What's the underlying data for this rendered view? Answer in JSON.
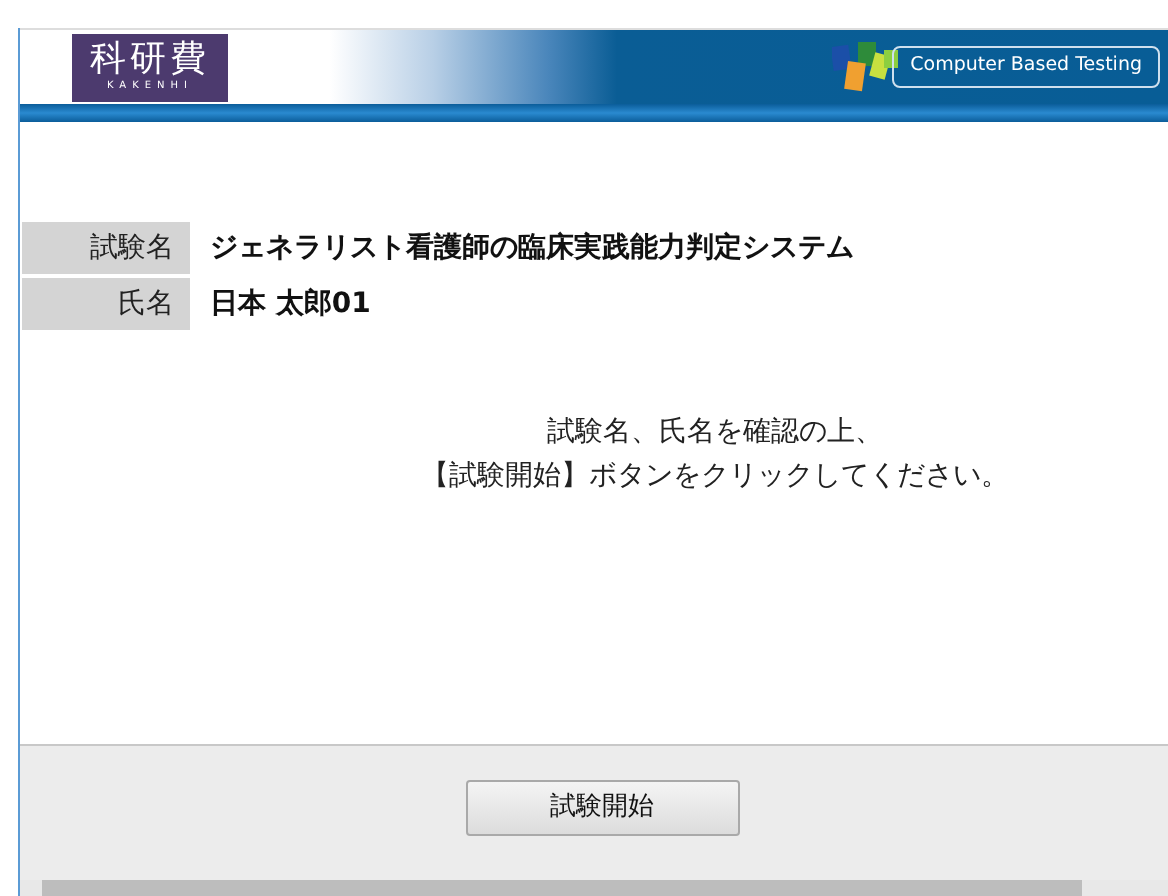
{
  "header": {
    "logo_title": "科研費",
    "logo_subtitle": "KAKENHI",
    "badge": "Computer Based Testing"
  },
  "info_rows": [
    {
      "label": "試験名",
      "value": "ジェネラリスト看護師の臨床実践能力判定システム"
    },
    {
      "label": "氏名",
      "value": "日本 太郎01"
    }
  ],
  "message": [
    "試験名、氏名を確認の上、",
    "【試験開始】ボタンをクリックしてください。"
  ],
  "footer": {
    "button": "試験開始"
  }
}
